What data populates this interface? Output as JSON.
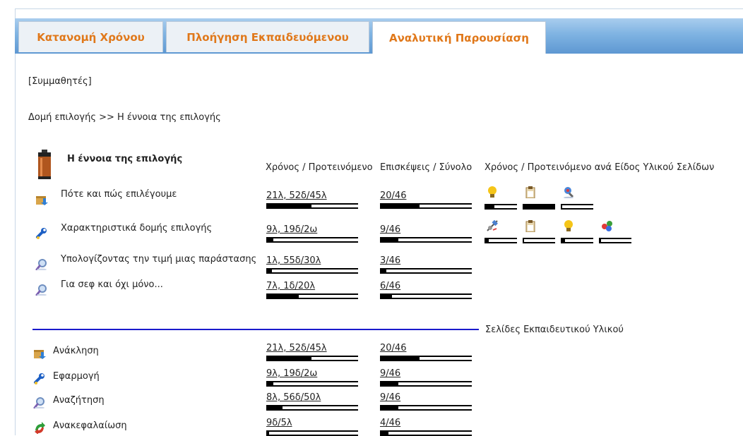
{
  "tabs": [
    {
      "label": "Κατανομή Χρόνου",
      "active": false
    },
    {
      "label": "Πλοήγηση Εκπαιδευόμενου",
      "active": false
    },
    {
      "label": "Αναλυτική Παρουσίαση",
      "active": true
    }
  ],
  "classmates_link": "[Συμμαθητές]",
  "breadcrumb": "Δομή επιλογής  >> Η έννοια της επιλογής",
  "concept": {
    "title": "Η έννοια της επιλογής",
    "icon": "battery-icon"
  },
  "columns": {
    "time": "Χρόνος / Προτεινόμενο",
    "visits": "Επισκέψεις / Σύνολο",
    "by_type": "Χρόνος / Προτεινόμενο ανά Είδος Υλικού Σελίδων"
  },
  "pages": [
    {
      "icon": "download-box-icon",
      "label": "Πότε και πώς επιλέγουμε",
      "time": "21λ, 52δ/45λ",
      "time_ratio": 0.49,
      "visits": "20/46",
      "visits_ratio": 0.43,
      "types": [
        {
          "icon": "lightbulb-icon",
          "ratio": 0.3
        },
        {
          "icon": "clipboard-icon",
          "ratio": 1.0
        },
        {
          "icon": "globe-search-icon",
          "ratio": 0.05
        }
      ]
    },
    {
      "icon": "wrench-icon",
      "label": "Χαρακτηριστικά δομής επιλογής",
      "time": "9λ, 19δ/2ω",
      "time_ratio": 0.08,
      "visits": "9/46",
      "visits_ratio": 0.2,
      "types": [
        {
          "icon": "satellite-icon",
          "ratio": 0.12
        },
        {
          "icon": "clipboard-icon",
          "ratio": 0.04
        },
        {
          "icon": "lightbulb-icon",
          "ratio": 0.12
        },
        {
          "icon": "molecule-icon",
          "ratio": 0.06
        }
      ]
    },
    {
      "icon": "magnifier-icon",
      "label": "Υπολογίζοντας την τιμή μιας παράστασης",
      "time": "1λ, 55δ/30λ",
      "time_ratio": 0.06,
      "visits": "3/46",
      "visits_ratio": 0.07,
      "types": []
    },
    {
      "icon": "magnifier-icon",
      "label": "Για σεφ και όχι μόνο...",
      "time": "7λ, 1δ/20λ",
      "time_ratio": 0.35,
      "visits": "6/46",
      "visits_ratio": 0.13,
      "types": []
    }
  ],
  "material_section": "Σελίδες Εκπαιδευτικού Υλικού",
  "material": [
    {
      "icon": "download-box-icon",
      "label": "Ανάκληση",
      "time": "21λ, 52δ/45λ",
      "time_ratio": 0.49,
      "visits": "20/46",
      "visits_ratio": 0.43
    },
    {
      "icon": "wrench-icon",
      "label": "Εφαρμογή",
      "time": "9λ, 19δ/2ω",
      "time_ratio": 0.08,
      "visits": "9/46",
      "visits_ratio": 0.2
    },
    {
      "icon": "magnifier-icon",
      "label": "Αναζήτηση",
      "time": "8λ, 56δ/50λ",
      "time_ratio": 0.18,
      "visits": "9/46",
      "visits_ratio": 0.2
    },
    {
      "icon": "recycle-arrows-icon",
      "label": "Ανακεφαλαίωση",
      "time": "9δ/5λ",
      "time_ratio": 0.03,
      "visits": "4/46",
      "visits_ratio": 0.09
    }
  ]
}
